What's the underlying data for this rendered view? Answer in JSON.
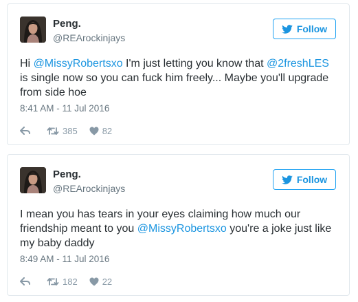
{
  "tweets": [
    {
      "name": "Peng.",
      "handle": "@REArockinjays",
      "follow_label": "Follow",
      "text_parts": [
        {
          "text": "Hi ",
          "mention": false
        },
        {
          "text": "@MissyRobertsxo",
          "mention": true
        },
        {
          "text": " I'm just letting you know that ",
          "mention": false
        },
        {
          "text": "@2freshLES",
          "mention": true
        },
        {
          "text": " is single now so you can fuck him freely... Maybe you'll upgrade from side hoe",
          "mention": false
        }
      ],
      "timestamp": "8:41 AM - 11 Jul 2016",
      "retweets": "385",
      "likes": "82"
    },
    {
      "name": "Peng.",
      "handle": "@REArockinjays",
      "follow_label": "Follow",
      "text_parts": [
        {
          "text": "I mean you has tears in your eyes claiming how much our friendship meant to you ",
          "mention": false
        },
        {
          "text": "@MissyRobertsxo",
          "mention": true
        },
        {
          "text": " you're a joke just like my baby daddy",
          "mention": false
        }
      ],
      "timestamp": "8:49 AM - 11 Jul 2016",
      "retweets": "182",
      "likes": "22"
    }
  ],
  "colors": {
    "twitter_blue": "#1da1f2",
    "link_blue": "#1b95e0",
    "secondary_text": "#66757f",
    "action_gray": "#8899a6",
    "border": "#e1e8ed"
  },
  "icons": {
    "follow": "twitter-bird-icon",
    "reply": "reply-icon",
    "retweet": "retweet-icon",
    "like": "heart-icon"
  }
}
